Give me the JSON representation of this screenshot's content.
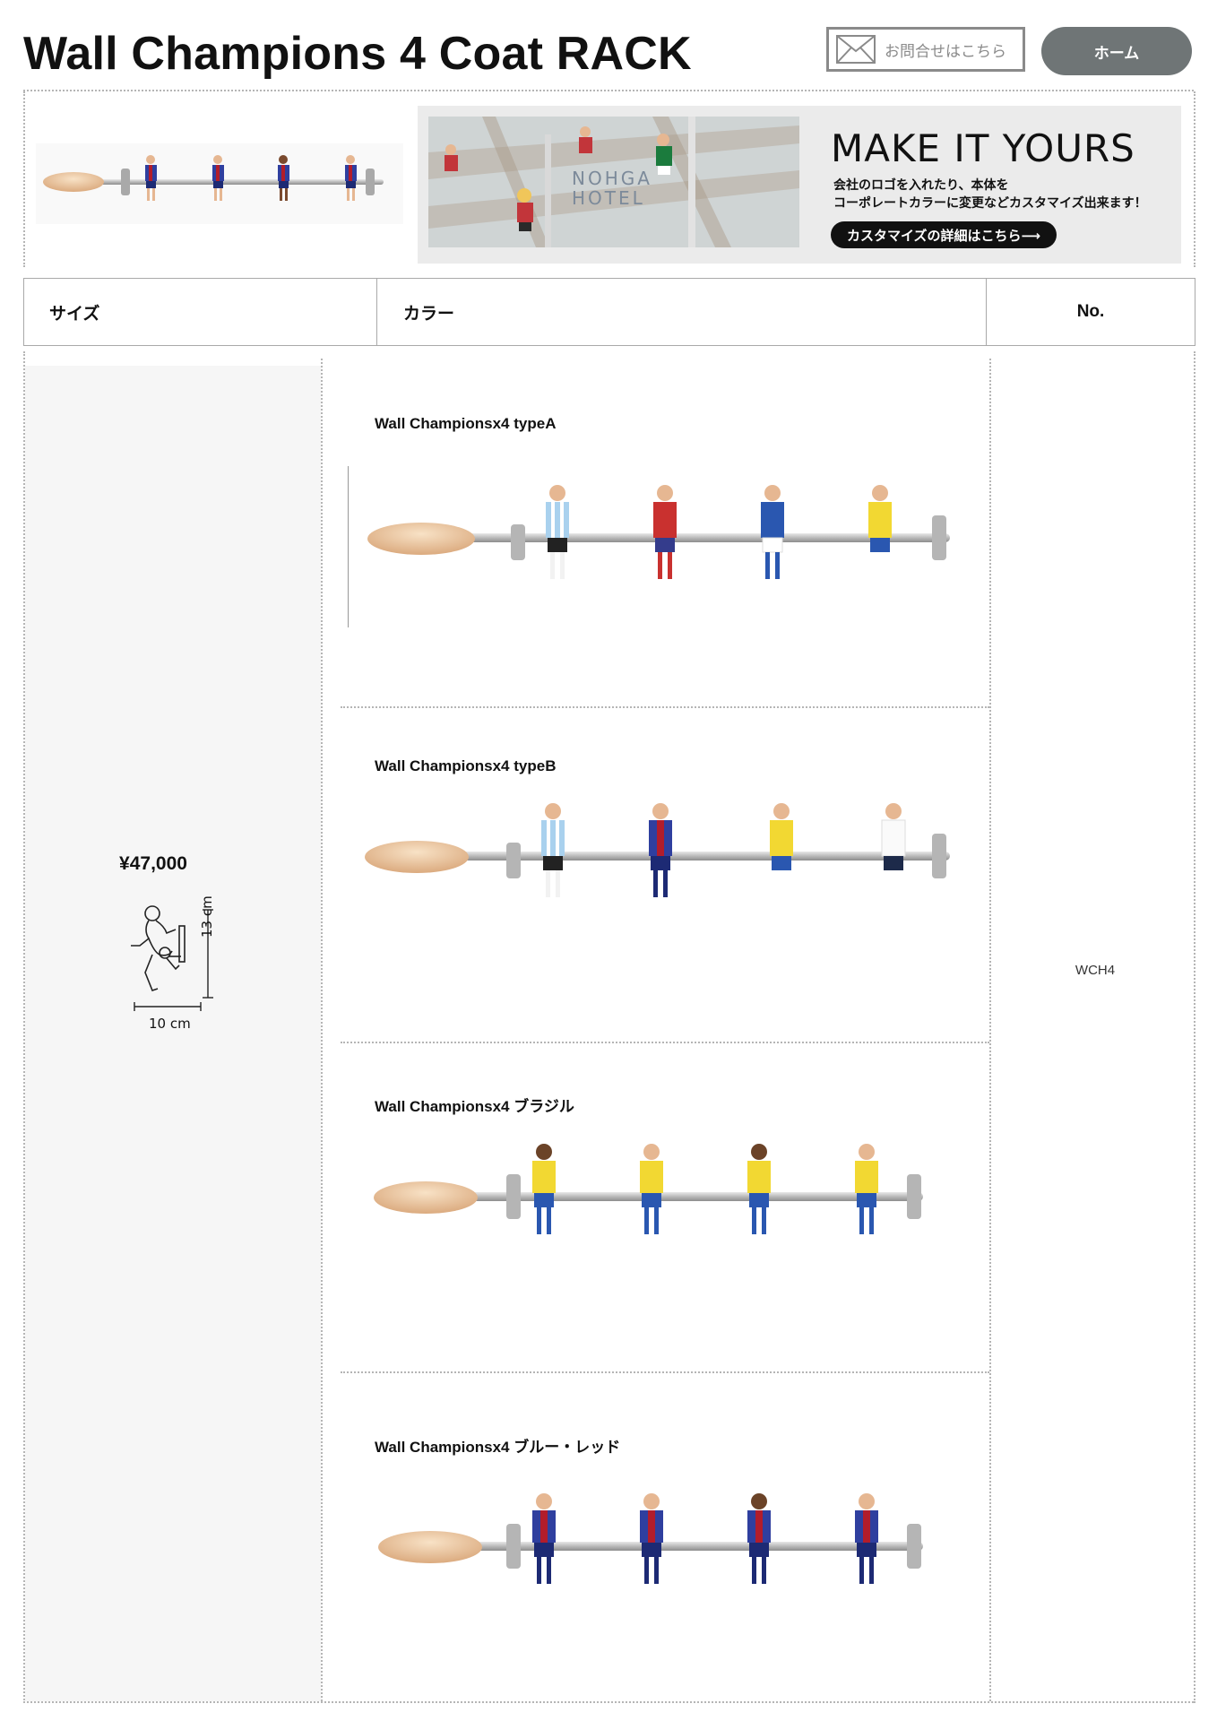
{
  "page": {
    "title": "Wall Champions 4 Coat RACK"
  },
  "header": {
    "contact_label": "お問合せはこちら",
    "home_label": "ホーム"
  },
  "banner": {
    "photo_logo_line1": "NOHGA",
    "photo_logo_line2": "HOTEL",
    "heading": "MAKE IT YOURS",
    "desc_line1": "会社のロゴを入れたり、本体を",
    "desc_line2": "コーポレートカラーに変更などカスタマイズ出来ます！",
    "cta_label": "カスタマイズの詳細はこちら⟶"
  },
  "table": {
    "headers": {
      "size": "サイズ",
      "color": "カラー",
      "no": "No."
    },
    "price": "¥47,000",
    "dimension_width": "10 cm",
    "dimension_height": "13 cm",
    "model_no": "WCH4",
    "variants": [
      {
        "name": "Wall Championsx4 typeA"
      },
      {
        "name": "Wall Championsx4 typeB"
      },
      {
        "name": "Wall Championsx4 ブラジル"
      },
      {
        "name": "Wall Championsx4 ブルー・レッド"
      }
    ]
  }
}
